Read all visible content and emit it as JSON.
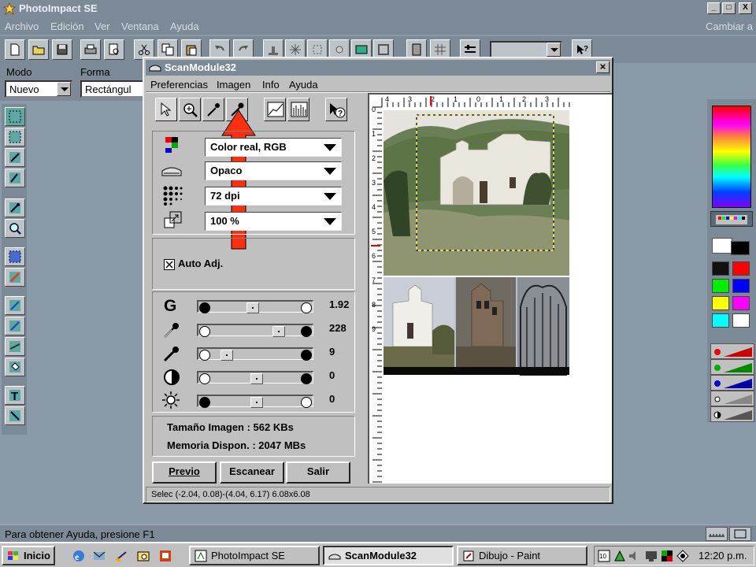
{
  "app": {
    "title": "PhotoImpact SE",
    "menu": [
      "Archivo",
      "Edición",
      "Ver",
      "Ventana",
      "Ayuda"
    ],
    "menu_right": "Cambiar a",
    "window_buttons": [
      "_",
      "□",
      "X"
    ]
  },
  "options": {
    "mode_label": "Modo",
    "mode_value": "Nuevo",
    "shape_label": "Forma",
    "shape_value": "Rectángul"
  },
  "scan_dialog": {
    "title": "ScanModule32",
    "close": "×",
    "menu": [
      "Preferencias",
      "Imagen",
      "Info",
      "Ayuda"
    ],
    "color_mode": "Color real, RGB",
    "scan_type": "Opaco",
    "resolution": "72 dpi",
    "scale": "100 %",
    "auto_adjust_label": "Auto Adj.",
    "auto_adjust_checked": true,
    "sliders": [
      {
        "name": "gamma",
        "value": "1.92",
        "position": 0.45
      },
      {
        "name": "highlight",
        "value": "228",
        "position": 0.78
      },
      {
        "name": "shadow",
        "value": "9",
        "position": 0.12
      },
      {
        "name": "contrast",
        "value": "0",
        "position": 0.5
      },
      {
        "name": "brightness",
        "value": "0",
        "position": 0.5
      }
    ],
    "image_size": "Tamaño Imagen : 562 KBs",
    "memory": "Memoria Dispon. : 2047 MBs",
    "buttons": {
      "preview": "Previo",
      "scan": "Escanear",
      "exit": "Salir"
    },
    "ruler_numbers": [
      "4",
      "3",
      "2",
      "1",
      "0",
      "1",
      "2",
      "3"
    ],
    "ruler_v_numbers": [
      "0",
      "1",
      "2",
      "3",
      "4",
      "5",
      "6",
      "7",
      "8",
      "9"
    ],
    "status": "Selec (-2.04, 0.08)-(4.04, 6.17) 6.08x6.08"
  },
  "status_bar": "Para obtener Ayuda, presione F1",
  "taskbar": {
    "start": "Inicio",
    "tasks": [
      "PhotoImpact SE",
      "ScanModule32",
      "Dibujo - Paint"
    ],
    "clock": "12:20 p.m."
  },
  "colors": {
    "swatches": [
      "#ffffff",
      "#000000",
      "#111111",
      "#ff0000",
      "#00ee00",
      "#0000ff",
      "#ffff00",
      "#ff00ff",
      "#00ffff",
      "#ffffff"
    ],
    "accent_arrow": "#ff3010"
  }
}
